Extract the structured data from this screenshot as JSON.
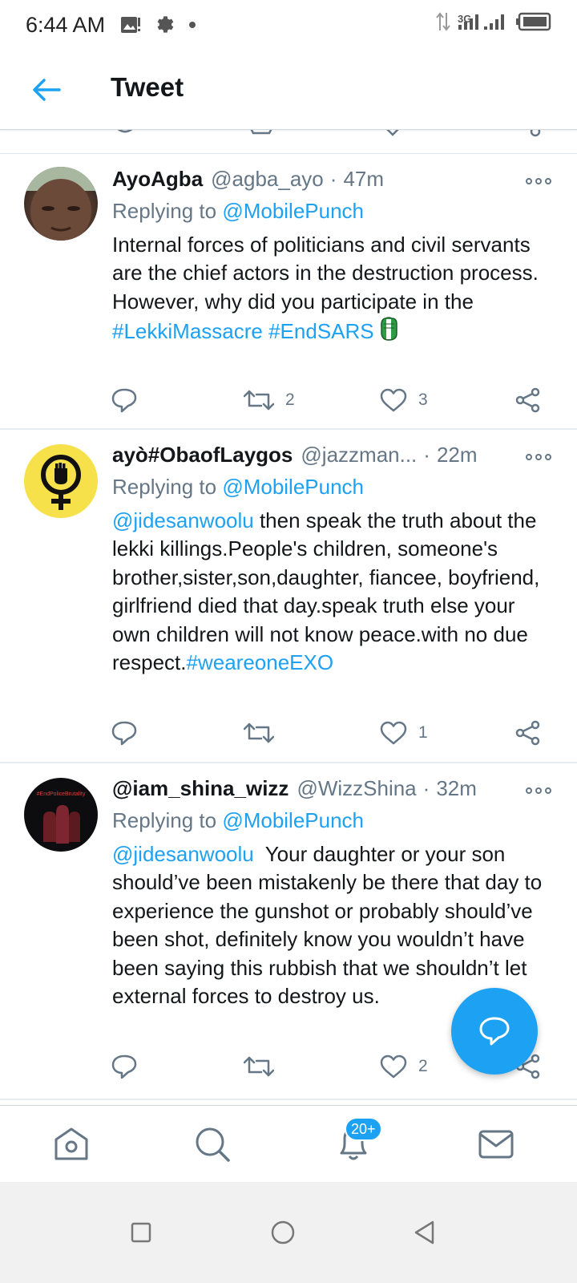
{
  "status_bar": {
    "time": "6:44 AM",
    "network": "3G",
    "icons": [
      "image-notification-icon",
      "settings-icon",
      "dot-icon",
      "data-arrows-icon",
      "signal-icon",
      "battery-icon"
    ]
  },
  "header": {
    "title": "Tweet",
    "back_icon": "arrow-left-icon"
  },
  "tweets": [
    {
      "name": "AyoAgba",
      "handle": "@agba_ayo",
      "separator": "·",
      "time": "47m",
      "replying_prefix": "Replying to ",
      "replying_to": "@MobilePunch",
      "text_plain": "Internal forces of politicians and civil servants are the chief actors in the destruction process. However, why did you participate in the ",
      "hashtag_1": "#LekkiMassacre",
      "hashtag_2": "#EndSARS",
      "emoji": "fist-emoji-nigeria",
      "retweets": "2",
      "likes": "3"
    },
    {
      "name": "ayò#ObaofLaygos",
      "handle": "@jazzman...",
      "separator": "·",
      "time": "22m",
      "replying_prefix": "Replying to ",
      "replying_to": "@MobilePunch",
      "mention": "@jidesanwoolu",
      "text_plain": " then speak the truth about the lekki killings.People's children, someone's brother,sister,son,daughter, fiancee, boyfriend, girlfriend died that day.speak truth else your own children will not know peace.with no due respect.",
      "hashtag_1": "#weareoneEXO",
      "retweets": "",
      "likes": "1"
    },
    {
      "name": "@iam_shina_wizz",
      "handle": "@WizzShina",
      "separator": "·",
      "time": "32m",
      "replying_prefix": "Replying to ",
      "replying_to": "@MobilePunch",
      "mention": "@jidesanwoolu",
      "text_plain": "  Your daughter or your son should’ve been mistakenly be there that day to experience the gunshot or probably should’ve been shot, definitely know you wouldn’t have been saying this rubbish that we shouldn’t let external forces to destroy us.",
      "avatar_text": "#EndPoliceBrutality",
      "retweets": "",
      "likes": "2"
    }
  ],
  "bottom_nav": {
    "items": [
      "home-icon",
      "search-icon",
      "notifications-icon",
      "messages-icon"
    ],
    "notification_badge": "20+"
  },
  "colors": {
    "accent": "#1da1f2",
    "text": "#14171a",
    "secondary": "#657786",
    "divider": "#e6ecf0"
  }
}
